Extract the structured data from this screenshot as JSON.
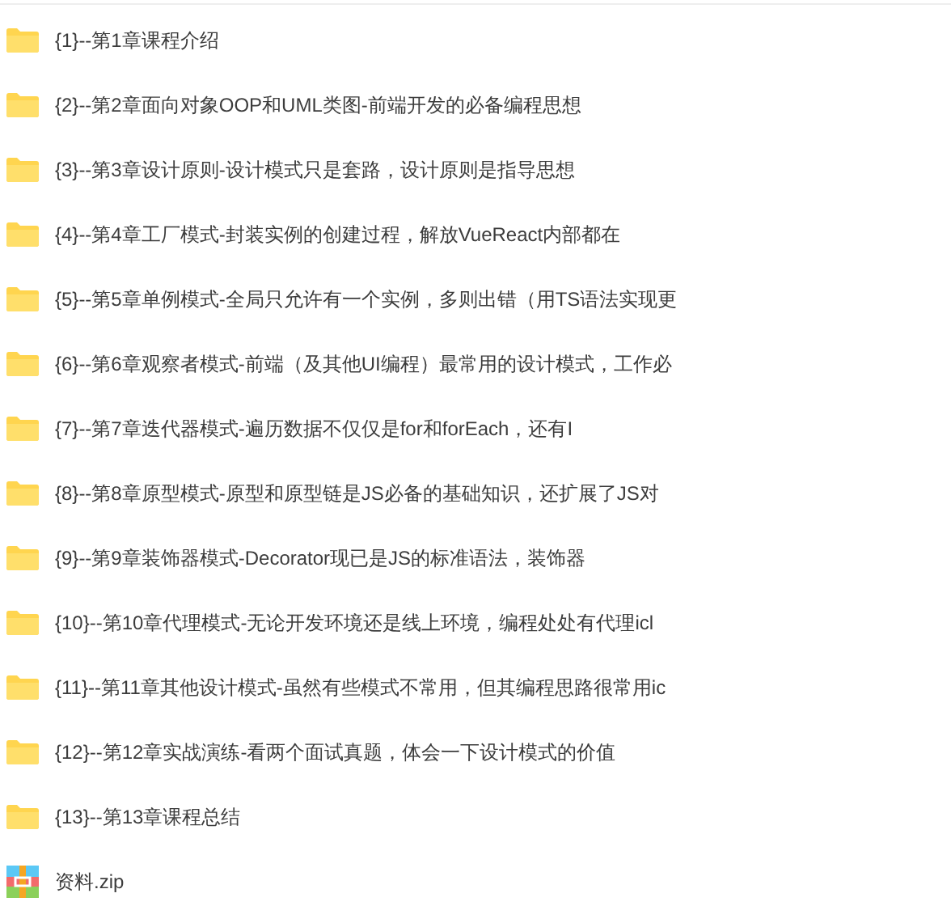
{
  "items": [
    {
      "kind": "folder",
      "name": "{1}--第1章课程介绍"
    },
    {
      "kind": "folder",
      "name": "{2}--第2章面向对象OOP和UML类图-前端开发的必备编程思想"
    },
    {
      "kind": "folder",
      "name": "{3}--第3章设计原则-设计模式只是套路，设计原则是指导思想"
    },
    {
      "kind": "folder",
      "name": "{4}--第4章工厂模式-封装实例的创建过程，解放VueReact内部都在"
    },
    {
      "kind": "folder",
      "name": "{5}--第5章单例模式-全局只允许有一个实例，多则出错（用TS语法实现更"
    },
    {
      "kind": "folder",
      "name": "{6}--第6章观察者模式-前端（及其他UI编程）最常用的设计模式，工作必"
    },
    {
      "kind": "folder",
      "name": "{7}--第7章迭代器模式-遍历数据不仅仅是for和forEach，还有I"
    },
    {
      "kind": "folder",
      "name": "{8}--第8章原型模式-原型和原型链是JS必备的基础知识，还扩展了JS对"
    },
    {
      "kind": "folder",
      "name": "{9}--第9章装饰器模式-Decorator现已是JS的标准语法，装饰器"
    },
    {
      "kind": "folder",
      "name": "{10}--第10章代理模式-无论开发环境还是线上环境，编程处处有代理icl"
    },
    {
      "kind": "folder",
      "name": "{11}--第11章其他设计模式-虽然有些模式不常用，但其编程思路很常用ic"
    },
    {
      "kind": "folder",
      "name": "{12}--第12章实战演练-看两个面试真题，体会一下设计模式的价值"
    },
    {
      "kind": "folder",
      "name": "{13}--第13章课程总结"
    },
    {
      "kind": "zip",
      "name": "资料.zip"
    }
  ]
}
